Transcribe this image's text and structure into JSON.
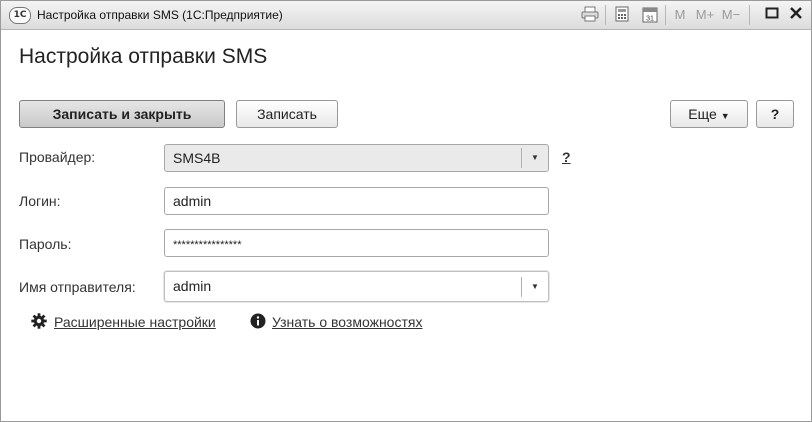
{
  "window": {
    "title": "Настройка отправки SMS  (1С:Предприятие)",
    "logo": "1С",
    "toolbar": {
      "print_icon": "printer-icon",
      "calculator_icon": "calculator-icon",
      "calendar_icon": "calendar-icon",
      "calendar_day": "31",
      "mem_m": "M",
      "mem_mplus": "M+",
      "mem_mminus": "M−",
      "maximize_icon": "maximize-icon",
      "close_icon": "close-icon"
    }
  },
  "page": {
    "title": "Настройка отправки SMS"
  },
  "commands": {
    "save_close_label": "Записать и закрыть",
    "save_label": "Записать",
    "more_label": "Еще",
    "help_label": "?"
  },
  "form": {
    "provider": {
      "label": "Провайдер:",
      "value": "SMS4B",
      "help": "?"
    },
    "login": {
      "label": "Логин:",
      "value": "admin"
    },
    "password": {
      "label": "Пароль:",
      "value": "****************"
    },
    "sender": {
      "label": "Имя отправителя:",
      "value": "admin"
    }
  },
  "links": {
    "advanced": "Расширенные настройки",
    "learn": "Узнать о возможностях"
  }
}
